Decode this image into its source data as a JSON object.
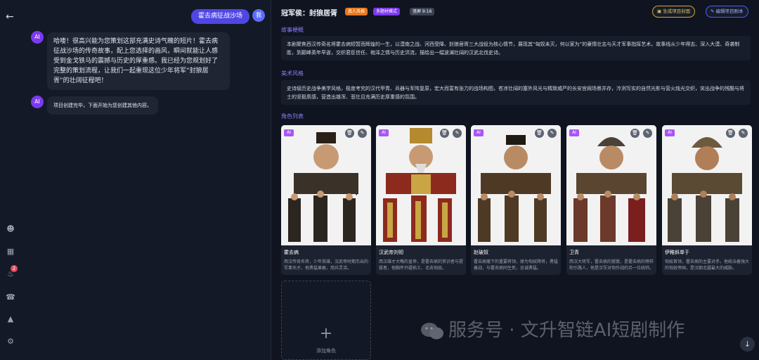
{
  "chat": {
    "user_message": "霍去病征战沙场",
    "user_avatar": "我",
    "ai_avatar": "AI",
    "ai_message_1": "哈喽！很高兴能为您策划这部充满史诗气魄的短片！霍去病征战沙场的传奇故事，配上您选择的画风，瞬间就能让人感受到金戈铁马的震撼与历史的厚重感。我已经为您规划好了完整的策划流程，让我们一起重现这位少年将军“封狼居胥”的壮阔征程吧！",
    "ai_message_2": "项目创建完毕，下面开始为您创建其他内容。",
    "notification_count": "2"
  },
  "header": {
    "title": "冠军侯：封狼居胥",
    "tags": [
      "真人风格",
      "多题材模式",
      "竖屏 9:16"
    ],
    "btn_cover": "生成项目封面",
    "btn_script": "编辑项目剧本"
  },
  "story": {
    "heading": "故事梗概",
    "text": "本剧聚焦西汉传奇名将霍去病短暂而辉煌的一生，以漠南之战、河西受降、封狼居胥三大战役为核心情节，展现其“匈奴未灭，何以家为”的豪情壮志与天才军事指挥艺术。故事线从少年得志、深入大漠、奇袭制胜，到巅峰英年早逝，交织君臣信任、袍泽之情与历史洪流，描绘出一幅波澜壮阔的汉武北伐史诗。"
  },
  "style": {
    "heading": "美术风格",
    "text": "史诗级历史战争美学风格，极度考究的汉代甲胄、兵器与军阵复原，宏大而富有张力的战场构图，苍凉壮阔的塞外风光与精致威严的长安宫阙场景并存，冷冽写实的自然光影与营火烛光交织，突出战争的残酷与将士的坚毅质感，营造出雄浑、悲壮且充满历史厚重感的氛围。"
  },
  "roles": {
    "heading": "角色列表",
    "ai_label": "AI",
    "items": [
      {
        "name": "霍去病",
        "desc": "西汉传奇名将，少年英雄，汉武帝时期杰出的军事天才。他勇猛果敢，用兵灵活。"
      },
      {
        "name": "汉武帝刘彻",
        "desc": "西汉雄才大略的皇帝，是霍去病的赏识者与提拔者，他胸怀开疆拓土、北击匈奴。"
      },
      {
        "name": "赵破奴",
        "desc": "霍去病麾下的重要将领，原为匈奴降将，勇猛善战，与霍去病同生死，忠诚勇猛。"
      },
      {
        "name": "卫青",
        "desc": "西汉大将军，霍去病的舅舅，是霍去病的榜样和引路人，他是汉军对匈作战的另一位统帅。"
      },
      {
        "name": "伊稚斜单于",
        "desc": "匈奴首领，霍去病的主要对手。他统治着强大的匈奴帝国，是汉朝北疆最大的威胁。"
      }
    ],
    "add_label": "添加角色"
  },
  "watermark": "服务号 · 文升智链AI短剧制作",
  "colors": {
    "accent": "#4f46e5",
    "purple": "#8b7cf6",
    "orange": "#f97316",
    "yellow": "#e3b23c"
  }
}
